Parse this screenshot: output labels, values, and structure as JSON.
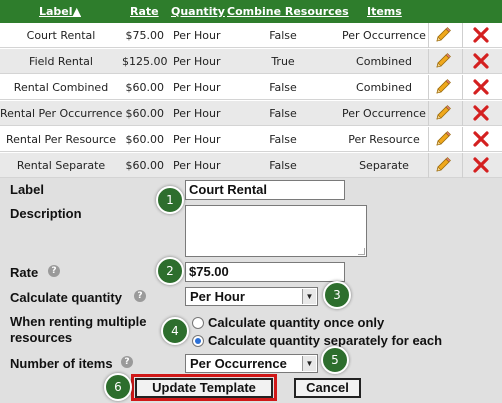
{
  "table": {
    "headers": {
      "label": "Label▲",
      "rate": "Rate",
      "quantity": "Quantity",
      "combine": "Combine Resources",
      "items": "Items"
    },
    "rows": [
      {
        "label": "Court Rental",
        "rate": "$75.00",
        "quantity": "Per Hour",
        "combine": "False",
        "items": "Per Occurrence"
      },
      {
        "label": "Field Rental",
        "rate": "$125.00",
        "quantity": "Per Hour",
        "combine": "True",
        "items": "Combined"
      },
      {
        "label": "Rental Combined",
        "rate": "$60.00",
        "quantity": "Per Hour",
        "combine": "False",
        "items": "Combined"
      },
      {
        "label": "Rental Per Occurrence",
        "rate": "$60.00",
        "quantity": "Per Hour",
        "combine": "False",
        "items": "Per Occurrence"
      },
      {
        "label": "Rental Per Resource",
        "rate": "$60.00",
        "quantity": "Per Hour",
        "combine": "False",
        "items": "Per Resource"
      },
      {
        "label": "Rental Separate",
        "rate": "$60.00",
        "quantity": "Per Hour",
        "combine": "False",
        "items": "Separate"
      }
    ],
    "edit_icon": "pencil-icon",
    "delete_icon": "x-icon"
  },
  "form": {
    "label_label": "Label",
    "label_value": "Court Rental",
    "description_label": "Description",
    "description_value": "",
    "rate_label": "Rate",
    "rate_value": "$75.00",
    "calc_qty_label": "Calculate quantity",
    "calc_qty_value": "Per Hour",
    "multi_label_line1": "When renting multiple",
    "multi_label_line2": "resources",
    "radio_once": "Calculate quantity once only",
    "radio_separate": "Calculate quantity separately for each",
    "radio_selected": "separate",
    "num_items_label": "Number of items",
    "num_items_value": "Per Occurrence",
    "help_glyph": "?",
    "update_button": "Update Template",
    "cancel_button": "Cancel"
  },
  "callouts": [
    "1",
    "2",
    "3",
    "4",
    "5",
    "6"
  ],
  "colors": {
    "header_bg": "#2e7d2c",
    "badge_bg": "#2d6e2d",
    "highlight": "#d01818",
    "edit_icon": "#e8a21a",
    "delete_icon": "#d42020"
  }
}
